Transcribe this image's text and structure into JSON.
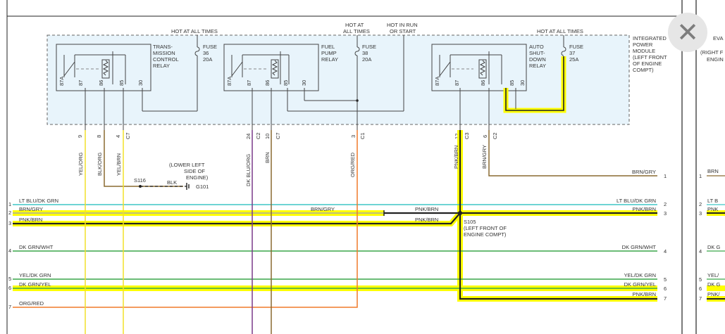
{
  "power": {
    "hot1": "HOT AT ALL TIMES",
    "hot2_line1": "HOT AT",
    "hot2_line2": "ALL TIMES",
    "run_line1": "HOT IN RUN",
    "run_line2": "OR START",
    "hot3": "HOT AT ALL TIMES"
  },
  "module": [
    "INTEGRATED",
    "POWER",
    "MODULE",
    "(LEFT FRONT",
    "OF ENGINE",
    "COMPT)"
  ],
  "neighbor_module": [
    "EVA",
    "(RIGHT F",
    "ENGIN"
  ],
  "relays": [
    {
      "name": [
        "TRANS-",
        "MISSION",
        "CONTROL",
        "RELAY"
      ],
      "fuse": [
        "FUSE",
        "36",
        "20A"
      ],
      "pins": [
        "87A",
        "87",
        "86",
        "85",
        "30"
      ]
    },
    {
      "name": [
        "FUEL",
        "PUMP",
        "RELAY"
      ],
      "fuse": [
        "FUSE",
        "38",
        "20A"
      ],
      "pins": [
        "87A",
        "87",
        "86",
        "85",
        "30"
      ]
    },
    {
      "name": [
        "AUTO",
        "SHUT-",
        "DOWN",
        "RELAY"
      ],
      "fuse": [
        "FUSE",
        "37",
        "25A"
      ],
      "pins": [
        "87A",
        "87",
        "86",
        "85",
        "30"
      ]
    }
  ],
  "connectors": {
    "c9": "9",
    "c8": "8",
    "c4": "4",
    "c24": "24",
    "c10": "10",
    "c3": "3",
    "c12": "12",
    "c6": "6",
    "cname": "C7",
    "c2name": "C2",
    "c1name": "C1",
    "c3name": "C3"
  },
  "wire_colors": {
    "yel_org": "YEL/ORG",
    "blk_org": "BLK/ORG",
    "yel_brn": "YEL/BRN",
    "dk_blu_org": "DK BLU/ORG",
    "brn": "BRN",
    "org_red": "ORG/RED",
    "pnk_brn": "PNK/BRN",
    "brn_gry": "BRN/GRY",
    "blk": "BLK"
  },
  "ground": {
    "splice": "S116",
    "id": "G101",
    "loc": [
      "(LOWER LEFT",
      "SIDE OF",
      "ENGINE)"
    ]
  },
  "splice": {
    "id": "S105",
    "loc": [
      "(LEFT FRONT OF",
      "ENGINE COMPT)"
    ]
  },
  "harness_left": [
    {
      "num": "1",
      "label": "LT BLU/DK GRN"
    },
    {
      "num": "2",
      "label": "BRN/GRY"
    },
    {
      "num": "3",
      "label": "PNK/BRN"
    },
    {
      "num": "4",
      "label": "DK GRN/WHT"
    },
    {
      "num": "5",
      "label": "YEL/DK GRN"
    },
    {
      "num": "6",
      "label": "DK GRN/YEL"
    },
    {
      "num": "7",
      "label": "ORG/RED"
    }
  ],
  "harness_right": [
    {
      "num": "1",
      "label": "BRN/GRY"
    },
    {
      "num": "2",
      "label": "LT BLU/DK GRN"
    },
    {
      "num": "3",
      "label": "PNK/BRN"
    },
    {
      "num": "4",
      "label": "DK GRN/WHT"
    },
    {
      "num": "5",
      "label": "YEL/DK GRN"
    },
    {
      "num": "6",
      "label": "DK GRN/YEL"
    },
    {
      "num": "7",
      "label": "PNK/BRN"
    }
  ],
  "mid_labels": {
    "brn_gry": "BRN/GRY",
    "pnk_brn_a": "PNK/BRN",
    "pnk_brn_b": "PNK/BRN"
  },
  "far_right": [
    {
      "num": "1",
      "label": "BRN"
    },
    {
      "num": "2",
      "label": "LT B"
    },
    {
      "num": "3",
      "label": "PNK"
    },
    {
      "num": "4",
      "label": "DK G"
    },
    {
      "num": "5",
      "label": "YEL/"
    },
    {
      "num": "6",
      "label": "DK G"
    },
    {
      "num": "7",
      "label": "PNK/"
    }
  ],
  "colors": {
    "highlight": "#ffff00",
    "module_fill": "#e8f4fb",
    "wire_cyan": "#3fc6c6",
    "wire_green": "#3aa64a",
    "wire_orange": "#f07a2a",
    "wire_yellow": "#f2e02a",
    "wire_purple": "#7a3a8a",
    "wire_brown": "#8a6a30"
  },
  "icons": {
    "close": "close-icon"
  },
  "close_glyph": "✕"
}
